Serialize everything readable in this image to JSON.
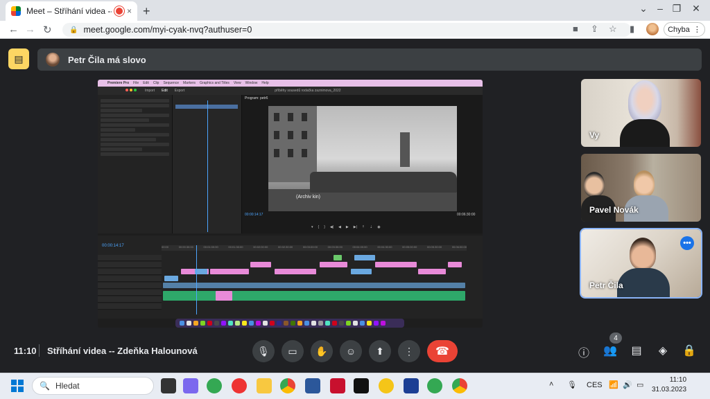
{
  "browser": {
    "tab_title": "Meet – Stříhání videa -- Zde",
    "new_tab": "+",
    "close_tab": "×",
    "win_min": "–",
    "win_max": "❐",
    "win_close": "✕",
    "url": "meet.google.com/myi-cyak-nvq?authuser=0",
    "error_chip": "Chyba"
  },
  "meet": {
    "speaking_banner": "Petr Čila má slovo",
    "clock": "11:10",
    "meeting_title": "Stříhání videa -- Zdeňka Halounová",
    "participants_count": "4",
    "tiles": [
      {
        "name": "Vy"
      },
      {
        "name": "Pavel Novák"
      },
      {
        "name": "Petr Čila"
      }
    ],
    "more_options": "•••"
  },
  "shared_screen": {
    "app_name": "Premiere Pro",
    "menu": [
      "File",
      "Edit",
      "Clip",
      "Sequence",
      "Markers",
      "Graphics and Titles",
      "View",
      "Window",
      "Help"
    ],
    "workspace_tabs": [
      "Import",
      "Edit",
      "Export"
    ],
    "project_title": "příběhy sousedů rodačka zaznimova_2022",
    "program_label": "Program: petr6",
    "video_caption": "(Archiv kin)",
    "timecode_left": "00:00:14:17",
    "timecode_right": "00:06:30:00",
    "timeline_timecode": "00:00:14:17",
    "ruler": [
      "00:00",
      "00:00:30:00",
      "00:01:00:00",
      "00:01:30:00",
      "00:02:00:00",
      "00:02:30:00",
      "00:03:00:00",
      "00:03:30:00",
      "00:04:00:00",
      "00:04:30:00",
      "00:05:00:00",
      "00:05:30:00",
      "00:06:00:00"
    ]
  },
  "taskbar": {
    "search_placeholder": "Hledat",
    "language": "CES",
    "time": "11:10",
    "date": "31.03.2023"
  },
  "colors": {
    "accent": "#8ab4f8",
    "hangup": "#ea4335",
    "notes": "#fdd663",
    "clip_pink": "#e88ad8",
    "clip_blue": "#6aa8e0",
    "audio_green": "#2ea86a"
  }
}
